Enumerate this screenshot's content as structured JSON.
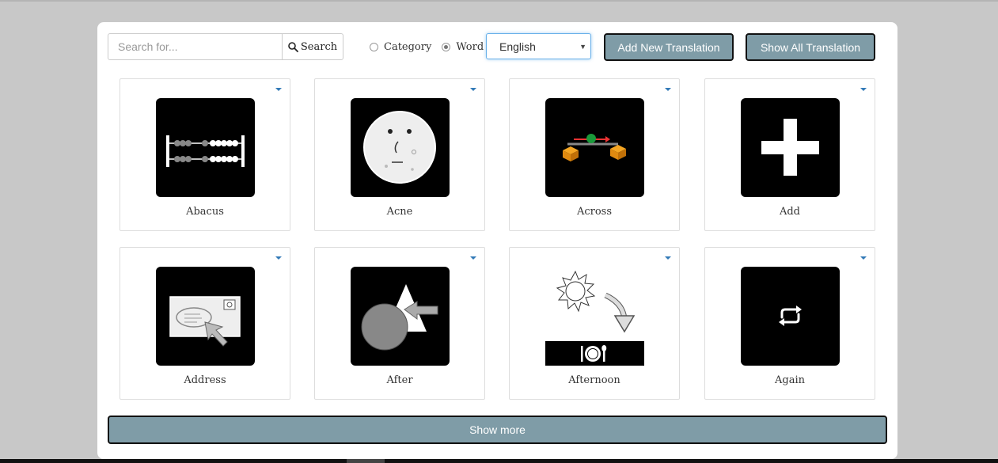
{
  "search": {
    "placeholder": "Search for...",
    "button_label": "Search",
    "icon": "search-icon"
  },
  "filter": {
    "options": [
      {
        "label": "Category",
        "checked": false
      },
      {
        "label": "Word",
        "checked": true
      }
    ]
  },
  "language": {
    "selected": "English"
  },
  "actions": {
    "add_label": "Add New Translation",
    "show_all_label": "Show All Translation"
  },
  "words": [
    {
      "label": "Abacus",
      "icon": "abacus-icon"
    },
    {
      "label": "Acne",
      "icon": "acne-face-icon"
    },
    {
      "label": "Across",
      "icon": "across-icon"
    },
    {
      "label": "Add",
      "icon": "plus-icon"
    },
    {
      "label": "Address",
      "icon": "address-envelope-icon"
    },
    {
      "label": "After",
      "icon": "after-shapes-icon"
    },
    {
      "label": "Afternoon",
      "icon": "afternoon-sun-icon"
    },
    {
      "label": "Again",
      "icon": "repeat-icon"
    }
  ],
  "show_more_label": "Show more",
  "colors": {
    "button_bg": "#7f9ca7",
    "card_border": "#dddddd",
    "dropdown_caret": "#337ab7"
  }
}
